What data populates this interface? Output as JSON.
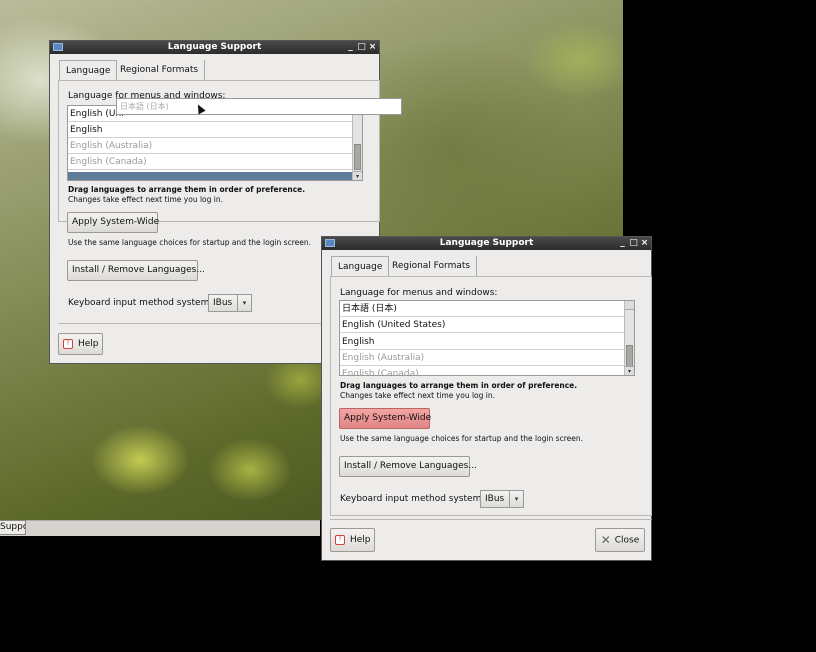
{
  "taskbar": {
    "item_label": "Support"
  },
  "back_window": {
    "title": "Language Support",
    "tabs": [
      "Language",
      "Regional Formats"
    ],
    "list_label": "Language for menus and windows:",
    "list_items": [
      "English (Uni",
      "English",
      "English (Australia)",
      "English (Canada)",
      ""
    ],
    "drag_ghost": "日本語 (日本)",
    "hint_bold": "Drag languages to arrange them in order of preference.",
    "hint_small": "Changes take effect next time you log in.",
    "apply_label": "Apply System-Wide",
    "apply_note": "Use the same language choices for startup and the login screen.",
    "install_label": "Install / Remove Languages...",
    "im_label": "Keyboard input method system:",
    "im_value": "IBus",
    "help_label": "Help"
  },
  "front_window": {
    "title": "Language Support",
    "tabs": [
      "Language",
      "Regional Formats"
    ],
    "list_label": "Language for menus and windows:",
    "list_items": [
      "日本語 (日本)",
      "English (United States)",
      "English",
      "English (Australia)",
      "English (Canada)"
    ],
    "hint_bold": "Drag languages to arrange them in order of preference.",
    "hint_small": "Changes take effect next time you log in.",
    "apply_label": "Apply System-Wide",
    "apply_note": "Use the same language choices for startup and the login screen.",
    "install_label": "Install / Remove Languages...",
    "im_label": "Keyboard input method system:",
    "im_value": "IBus",
    "help_label": "Help",
    "close_label": "Close"
  },
  "titlebar_buttons": {
    "minimize": "_",
    "maximize": "□",
    "close": "×"
  },
  "icons": {
    "help": "help-icon",
    "close": "close-icon",
    "combo_arrow": "▾",
    "scroll_down": "▾"
  },
  "colors": {
    "selected_row": "#5f7d99",
    "apply_hover": "#e08686",
    "titlebar": "#2b2b2b"
  }
}
